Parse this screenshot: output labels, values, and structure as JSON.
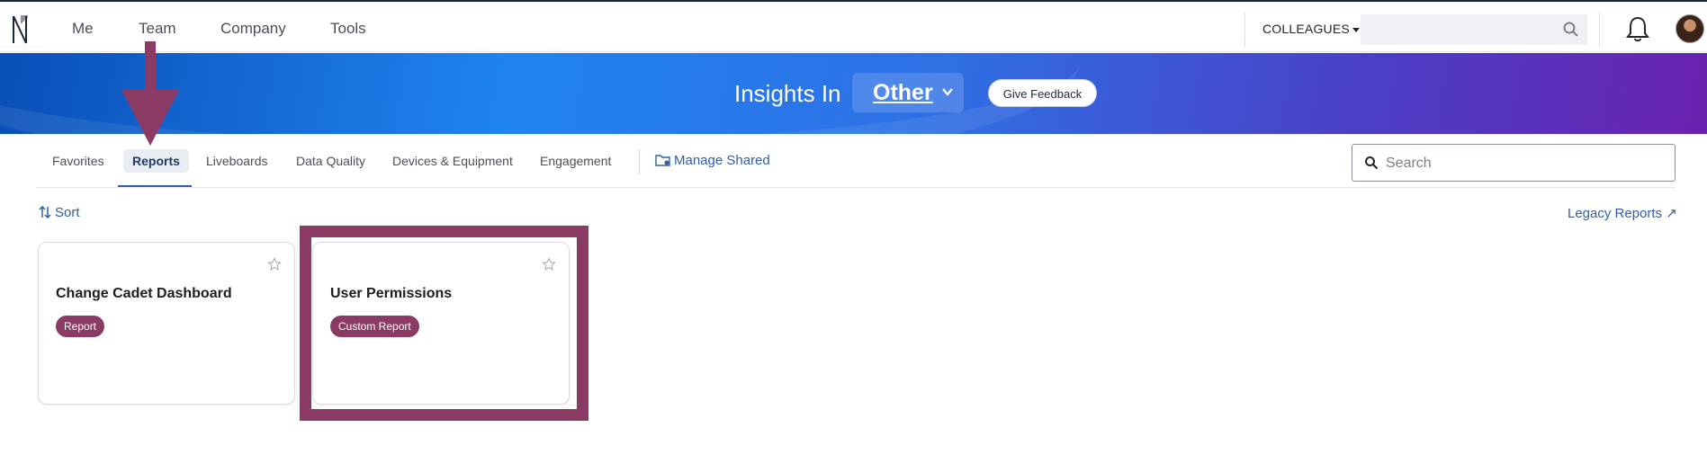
{
  "topnav": {
    "items": [
      "Me",
      "Team",
      "Company",
      "Tools"
    ],
    "colleagues_label": "COLLEAGUES",
    "search_value": ""
  },
  "banner": {
    "title": "Insights In",
    "dropdown_value": "Other",
    "feedback_label": "Give Feedback"
  },
  "tabs": {
    "items": [
      "Favorites",
      "Reports",
      "Liveboards",
      "Data Quality",
      "Devices & Equipment",
      "Engagement"
    ],
    "active": "Reports",
    "manage_shared_label": "Manage Shared",
    "search_placeholder": "Search"
  },
  "toolbar": {
    "sort_label": "Sort",
    "legacy_label": "Legacy Reports ↗"
  },
  "cards": [
    {
      "title": "Change Cadet Dashboard",
      "badge": "Report"
    },
    {
      "title": "User Permissions",
      "badge": "Custom Report"
    }
  ],
  "colors": {
    "accent_purple": "#8b3a63",
    "link_blue": "#2f5ea8",
    "banner_start": "#0a4fb8",
    "banner_end": "#6a22b0"
  },
  "icons": [
    "logo-icon",
    "search-icon",
    "bell-icon",
    "chevron-down-icon",
    "folder-gear-icon",
    "sort-icon",
    "external-link-icon",
    "star-icon"
  ]
}
